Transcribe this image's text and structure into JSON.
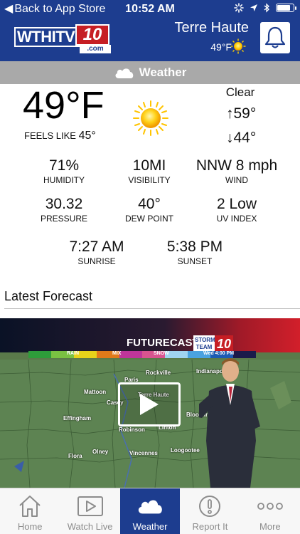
{
  "status_bar": {
    "back_label": "Back to App Store",
    "time": "10:52 AM"
  },
  "header": {
    "logo_word": "WTHITV",
    "logo_number": "10",
    "logo_suffix": ".com",
    "city": "Terre Haute",
    "temp": "49°F",
    "alert_icon": "bell-icon"
  },
  "section": {
    "title": "Weather",
    "icon": "cloud-icon"
  },
  "current": {
    "temp": "49°F",
    "feels_label": "FEELS LIKE",
    "feels_value": "45°",
    "condition": "Clear",
    "high": "↑59°",
    "low": "↓44°",
    "icon": "sun-icon"
  },
  "stats": [
    {
      "value": "71%",
      "label": "HUMIDITY"
    },
    {
      "value": "10MI",
      "label": "VISIBILITY"
    },
    {
      "value": "NNW 8 mph",
      "label": "WIND"
    },
    {
      "value": "30.32",
      "label": "PRESSURE"
    },
    {
      "value": "40°",
      "label": "DEW POINT"
    },
    {
      "value": "2 Low",
      "label": "UV INDEX"
    },
    {
      "value": "7:27 AM",
      "label": "SUNRISE"
    },
    {
      "value": "5:38 PM",
      "label": "SUNSET"
    }
  ],
  "latest_forecast": {
    "heading": "Latest Forecast",
    "video": {
      "banner": "FUTURECAST",
      "brand_top": "STORM TEAM",
      "brand_num": "10",
      "legend": [
        "RAIN",
        "MIX",
        "SNOW",
        "Wed 4:00 PM"
      ],
      "towns": [
        "Rockville",
        "Indianapolis",
        "Paris",
        "Mattoon",
        "Terre Haute",
        "Casey",
        "Effingham",
        "Bloomington",
        "Robinson",
        "Linton",
        "Olney",
        "Vincennes",
        "Loogootee",
        "Flora"
      ]
    }
  },
  "tabs": [
    {
      "label": "Home",
      "icon": "home-icon"
    },
    {
      "label": "Watch Live",
      "icon": "play-icon"
    },
    {
      "label": "Weather",
      "icon": "cloud-icon"
    },
    {
      "label": "Report It",
      "icon": "alert-icon"
    },
    {
      "label": "More",
      "icon": "more-icon"
    }
  ],
  "colors": {
    "brand_blue": "#1d3d8f",
    "brand_red": "#c61e24",
    "section_gray": "#a9a9a9"
  }
}
